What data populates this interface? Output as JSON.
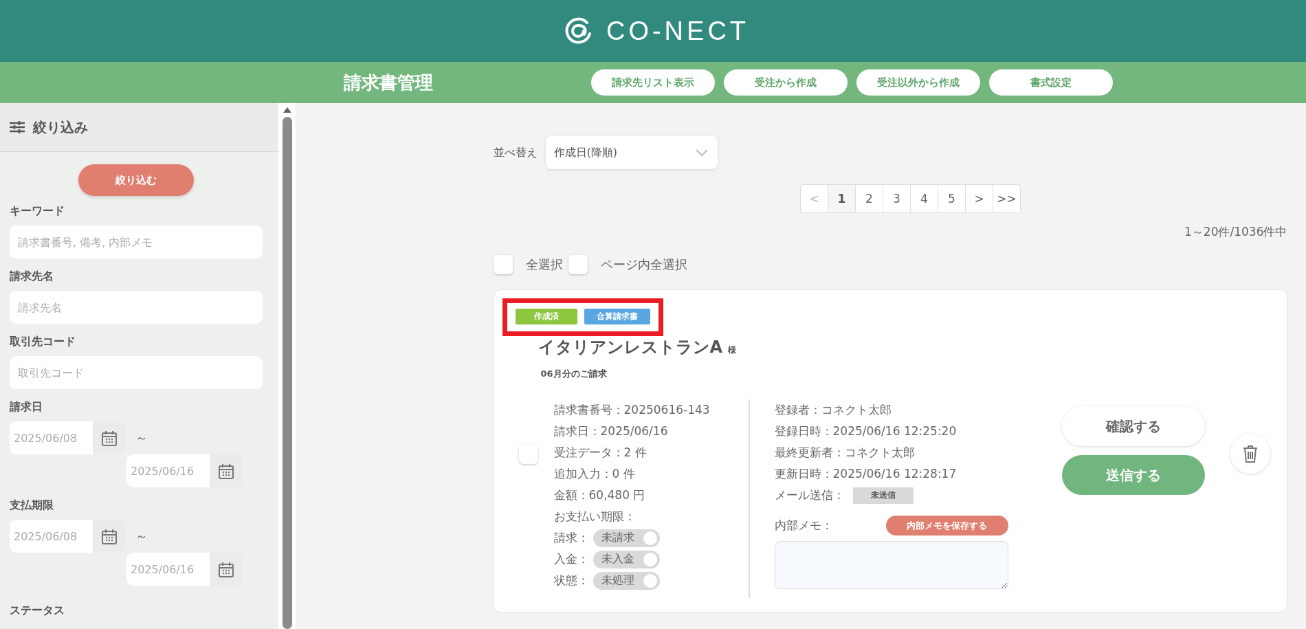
{
  "header": {
    "brand": "CO-NECT"
  },
  "toolbar": {
    "title": "請求書管理",
    "buttons": [
      "請求先リスト表示",
      "受注から作成",
      "受注以外から作成",
      "書式設定"
    ]
  },
  "sidebar": {
    "title": "絞り込み",
    "apply_button": "絞り込む",
    "fields": [
      {
        "kind": "text",
        "label": "キーワード",
        "placeholder": "請求書番号, 備考, 内部メモ"
      },
      {
        "kind": "text",
        "label": "請求先名",
        "placeholder": "請求先名"
      },
      {
        "kind": "text",
        "label": "取引先コード",
        "placeholder": "取引先コード"
      },
      {
        "kind": "range",
        "label": "請求日",
        "from": "2025/06/08",
        "separator": "～",
        "to": "2025/06/16"
      },
      {
        "kind": "range",
        "label": "支払期限",
        "from": "2025/06/08",
        "separator": "～",
        "to": "2025/06/16"
      },
      {
        "kind": "heading",
        "label": "ステータス"
      }
    ]
  },
  "sort": {
    "label": "並べ替え",
    "value": "作成日(降順)"
  },
  "pagination": [
    {
      "label": "<",
      "selected": false,
      "disabled": true
    },
    {
      "label": "1",
      "selected": true,
      "disabled": false
    },
    {
      "label": "2",
      "selected": false,
      "disabled": false
    },
    {
      "label": "3",
      "selected": false,
      "disabled": false
    },
    {
      "label": "4",
      "selected": false,
      "disabled": false
    },
    {
      "label": "5",
      "selected": false,
      "disabled": false
    },
    {
      "label": ">",
      "selected": false,
      "disabled": false
    },
    {
      "label": ">>",
      "selected": false,
      "disabled": false
    }
  ],
  "count": "1～20件/1036件中",
  "select_options": [
    {
      "label": "全選択",
      "checked": false
    },
    {
      "label": "ページ内全選択",
      "checked": false
    }
  ],
  "invoices": [
    {
      "tags": [
        {
          "label": "作成済",
          "color": "#8dc63f"
        },
        {
          "label": "合算請求書",
          "color": "#5aa6e0"
        }
      ],
      "highlighted": true,
      "customer": "イタリアンレストランA",
      "honorific": "様",
      "period": "06月分のご請求",
      "checked": false,
      "details": [
        "請求書番号：20250616-143",
        "請求日：2025/06/16",
        "受注データ：2 件",
        "追加入力：0 件",
        "金額：60,480 円",
        "お支払い期限："
      ],
      "toggles": [
        {
          "label": "請求：",
          "value": "未請求",
          "on": false
        },
        {
          "label": "入金：",
          "value": "未入金",
          "on": false
        },
        {
          "label": "状態：",
          "value": "未処理",
          "on": false
        }
      ],
      "meta": [
        "登録者：コネクト太郎",
        "登録日時：2025/06/16 12:25:20",
        "最終更新者：コネクト太郎",
        "更新日時：2025/06/16 12:28:17"
      ],
      "mail": {
        "label": "メール送信：",
        "status": "未送信"
      },
      "memo": {
        "label": "内部メモ：",
        "save_button": "内部メモを保存する"
      },
      "actions": [
        {
          "label": "確認する",
          "kind": "secondary"
        },
        {
          "label": "送信する",
          "kind": "primary"
        }
      ]
    }
  ]
}
